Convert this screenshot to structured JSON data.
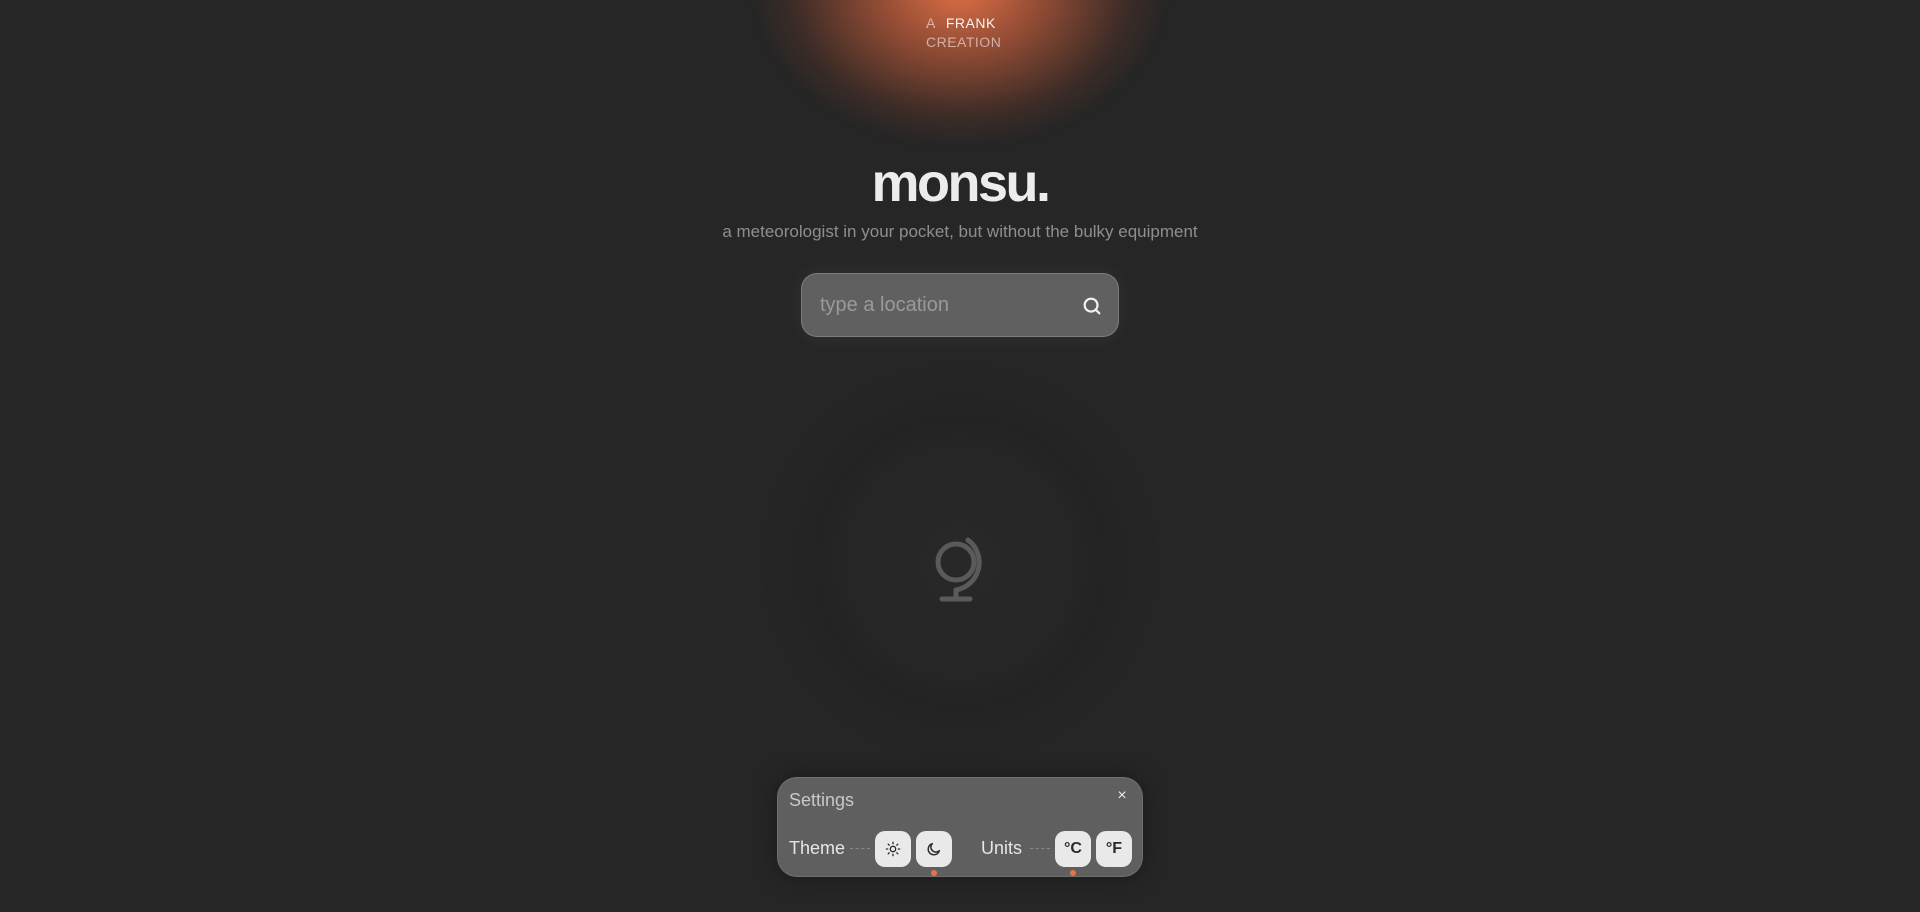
{
  "credit": {
    "prefix": "A",
    "name": "FRANK",
    "suffix": "CREATION"
  },
  "header": {
    "title": "monsu.",
    "subtitle": "a meteorologist in your pocket, but without the bulky equipment"
  },
  "search": {
    "placeholder": "type a location",
    "value": "",
    "icon": "search-icon"
  },
  "placeholder_illustration": {
    "icon": "globe-icon"
  },
  "settings": {
    "title": "Settings",
    "close_label": "×",
    "theme": {
      "label": "Theme",
      "options": [
        "light",
        "dark"
      ],
      "option_icons": [
        "sun-icon",
        "moon-icon"
      ],
      "selected": "dark"
    },
    "units": {
      "label": "Units",
      "options": [
        "°C",
        "°F"
      ],
      "selected": "°C"
    }
  },
  "colors": {
    "accent": "#e87348",
    "background": "#262626",
    "panel": "#5f5f5f"
  }
}
